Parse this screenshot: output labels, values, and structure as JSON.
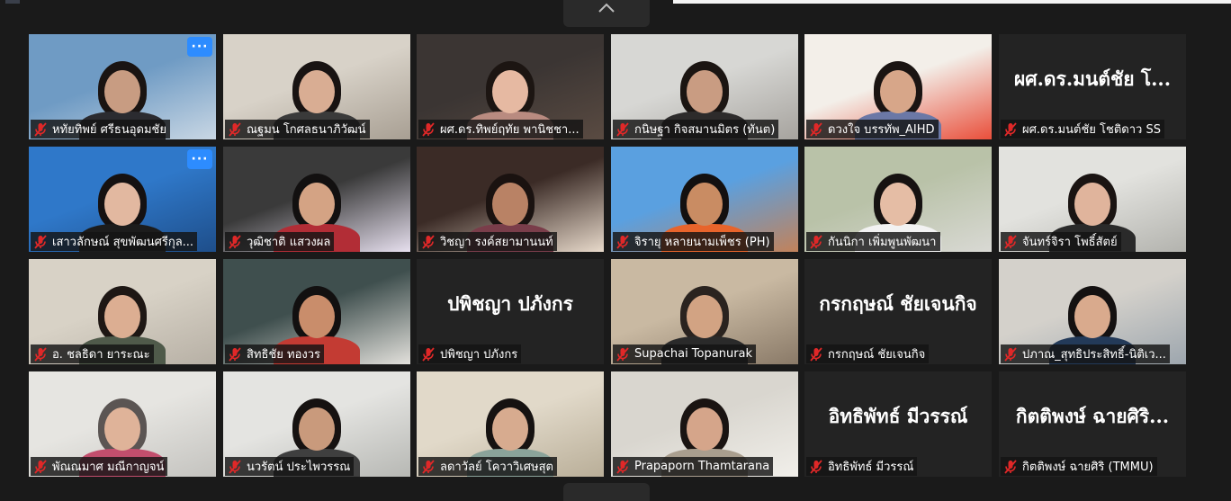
{
  "participants": [
    {
      "name": "หทัยทิพย์ ศรีธนอุดมชัย",
      "video": true,
      "more_menu": true,
      "bg": "#6f9bc4",
      "bg2": "#c9d7e4",
      "skin": "#c89c82",
      "hair": "#1a1412",
      "shirt": "#2b2b30"
    },
    {
      "name": "ณฐมน โกศลธนาภิวัฒน์",
      "video": true,
      "bg": "#d8d2c8",
      "bg2": "#a89f93",
      "skin": "#d9ad93",
      "hair": "#181312",
      "shirt": "#3a3a3a"
    },
    {
      "name": "ผศ.ดร.ทิพย์ฤทัย พานิชชา...",
      "video": true,
      "bg": "#3b3533",
      "bg2": "#5a4b42",
      "skin": "#e6b9a2",
      "hair": "#1c1512",
      "shirt": "#b98b80"
    },
    {
      "name": "กนิษฐา กิจสมานมิตร (ทันต)",
      "video": true,
      "bg": "#d7d7d4",
      "bg2": "#a6a39e",
      "skin": "#c99c82",
      "hair": "#1b1512",
      "shirt": "#2d2b2b"
    },
    {
      "name": "ดวงใจ บรรทัพ_AIHD",
      "video": true,
      "bg": "#f3efe9",
      "bg2": "#e94f3b",
      "skin": "#d7a689",
      "hair": "#1a1412",
      "shirt": "#6b78a6"
    },
    {
      "name": "ผศ.ดร.มนต์ชัย โชติดาว SS",
      "video": false,
      "display_text": "ผศ.ดร.มนต์ชัย โ..."
    },
    {
      "name": "เสาวลักษณ์ สุขพัฒนศรีกุล...",
      "video": true,
      "more_menu": true,
      "bg": "#2f78c9",
      "bg2": "#1e4e8a",
      "skin": "#e2b8a0",
      "hair": "#151111",
      "shirt": "#1c1c1c"
    },
    {
      "name": "วุฒิชาติ แสวงผล",
      "video": true,
      "bg": "#3a3a3a",
      "bg2": "#e7e0ef",
      "skin": "#d4a384",
      "hair": "#121010",
      "shirt": "#b22d36"
    },
    {
      "name": "วิชญา รงค์สยามานนท์",
      "video": true,
      "bg": "#3b2b26",
      "bg2": "#e8dacb",
      "skin": "#b98265",
      "hair": "#1a1210",
      "shirt": "#7a3d4a"
    },
    {
      "name": "จิรายุ หลายนามเพ็ชร (PH)",
      "video": true,
      "bg": "#5aa0e0",
      "bg2": "#c2825a",
      "skin": "#c98c63",
      "hair": "#131010",
      "shirt": "#e8642b"
    },
    {
      "name": "กันนิกา เพิ่มพูนพัฒนา",
      "video": true,
      "bg": "#b9c2a8",
      "bg2": "#d9d9d4",
      "skin": "#e5bda5",
      "hair": "#161211",
      "shirt": "#f2f2f2"
    },
    {
      "name": "จันทร์จิรา โพธิ์สัตย์",
      "video": true,
      "bg": "#e2e2de",
      "bg2": "#b3b3ae",
      "skin": "#e0b49c",
      "hair": "#1a1412",
      "shirt": "#2a2a2a"
    },
    {
      "name": "อ. ชลธิดา ยาระณะ",
      "video": true,
      "bg": "#d8d2c6",
      "bg2": "#b7b0a5",
      "skin": "#dcae92",
      "hair": "#1e1714",
      "shirt": "#4f5a4a"
    },
    {
      "name": "สิทธิชัย ทองวร",
      "video": true,
      "bg": "#3f4f4e",
      "bg2": "#e3e1dc",
      "skin": "#c98d6b",
      "hair": "#121010",
      "shirt": "#c33b33"
    },
    {
      "name": "ปพิชญา ปภังกร",
      "video": false,
      "display_text": "ปพิชญา ปภังกร"
    },
    {
      "name": "Supachai Topanurak",
      "video": true,
      "bg": "#c9b9a2",
      "bg2": "#8a7a68",
      "skin": "#d2a383",
      "hair": "#2a231f",
      "shirt": "#2a2a2a"
    },
    {
      "name": "กรกฤษณ์ ชัยเจนกิจ",
      "video": false,
      "display_text": "กรกฤษณ์ ชัยเจนกิจ"
    },
    {
      "name": "ปภาณ_สุทธิประสิทธิ์-นิติเว...",
      "video": true,
      "bg": "#d4d1cb",
      "bg2": "#9da6ae",
      "skin": "#d9aa8d",
      "hair": "#141111",
      "shirt": "#233a59"
    },
    {
      "name": "พัณณมาศ มณีกาญจน์",
      "video": true,
      "bg": "#e6e5e1",
      "bg2": "#c4c3bf",
      "skin": "#dfb399",
      "hair": "#5b5553",
      "shirt": "#c24e6d"
    },
    {
      "name": "นวรัตน์ ประไพวรรณ",
      "video": true,
      "bg": "#e4e4e1",
      "bg2": "#b7b8b4",
      "skin": "#c99a7c",
      "hair": "#161211",
      "shirt": "#3f3f3f"
    },
    {
      "name": "ลดาวัลย์ โควาวิเศษสุต",
      "video": true,
      "bg": "#e1d9c9",
      "bg2": "#b9ae98",
      "skin": "#d7ab8f",
      "hair": "#161211",
      "shirt": "#8aa39a"
    },
    {
      "name": "Prapaporn Thamtarana",
      "video": true,
      "bg": "#d9d6cf",
      "bg2": "#f1efea",
      "skin": "#d5a58a",
      "hair": "#1a1412",
      "shirt": "#a99e8e"
    },
    {
      "name": "อิทธิพัทธ์ มีวรรณ์",
      "video": false,
      "display_text": "อิทธิพัทธ์ มีวรรณ์"
    },
    {
      "name": "กิตติพงษ์ ฉายศิริ (TMMU)",
      "video": false,
      "display_text": "กิตติพงษ์ ฉายศิริ..."
    }
  ],
  "icons": {
    "mic": "mic-muted-icon",
    "more": "more-options-icon",
    "collapse": "chevron-up-icon"
  },
  "more_label": "···",
  "colors": {
    "muted_mic": "#e02828",
    "accent": "#2d8cff",
    "bg": "#1a1a1a"
  }
}
